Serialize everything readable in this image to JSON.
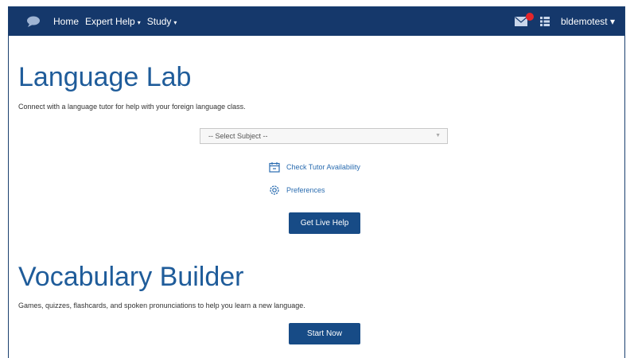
{
  "nav": {
    "links": [
      {
        "label": "Home"
      },
      {
        "label": "Expert Help",
        "caret": "▾"
      },
      {
        "label": "Study",
        "caret": "▾"
      }
    ],
    "user": "bldemotest ▾",
    "colors": {
      "bar": "#15386b",
      "badge": "#e3262b"
    },
    "icons": [
      "chat-bubble-logo-icon",
      "mail-icon",
      "grid-icon"
    ]
  },
  "language_lab": {
    "title": "Language Lab",
    "description": "Connect with a language tutor for help with your foreign language class.",
    "select_placeholder": "-- Select Subject --",
    "check_availability": "Check Tutor Availability",
    "preferences": "Preferences",
    "button": "Get Live Help"
  },
  "vocabulary": {
    "title": "Vocabulary Builder",
    "description": "Games, quizzes, flashcards, and spoken pronunciations to help you learn a new language.",
    "button": "Start Now"
  },
  "accent_color": "#1f5c9a"
}
